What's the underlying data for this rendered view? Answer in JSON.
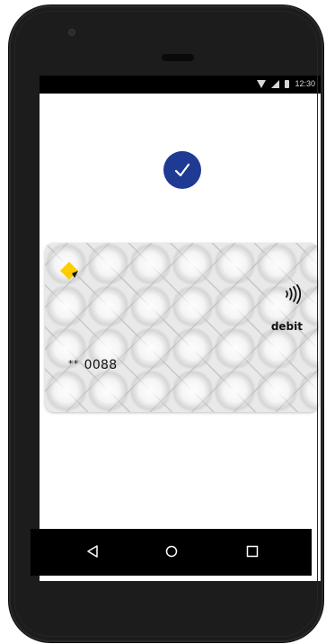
{
  "status_bar": {
    "time": "12:30",
    "wifi_icon": "wifi-icon",
    "signal_icon": "cellular-signal-icon",
    "battery_icon": "battery-icon"
  },
  "payment_status": {
    "icon": "checkmark-icon",
    "badge_color": "#1f3a93"
  },
  "card": {
    "logo_icon": "bank-diamond-logo",
    "logo_color": "#ffcc00",
    "contactless_icon": "contactless-icon",
    "type": "debit",
    "number_mask": "**",
    "last_four": "0088"
  },
  "nav_bar": {
    "back_icon": "back-triangle-icon",
    "home_icon": "home-circle-icon",
    "recents_icon": "recents-square-icon"
  }
}
